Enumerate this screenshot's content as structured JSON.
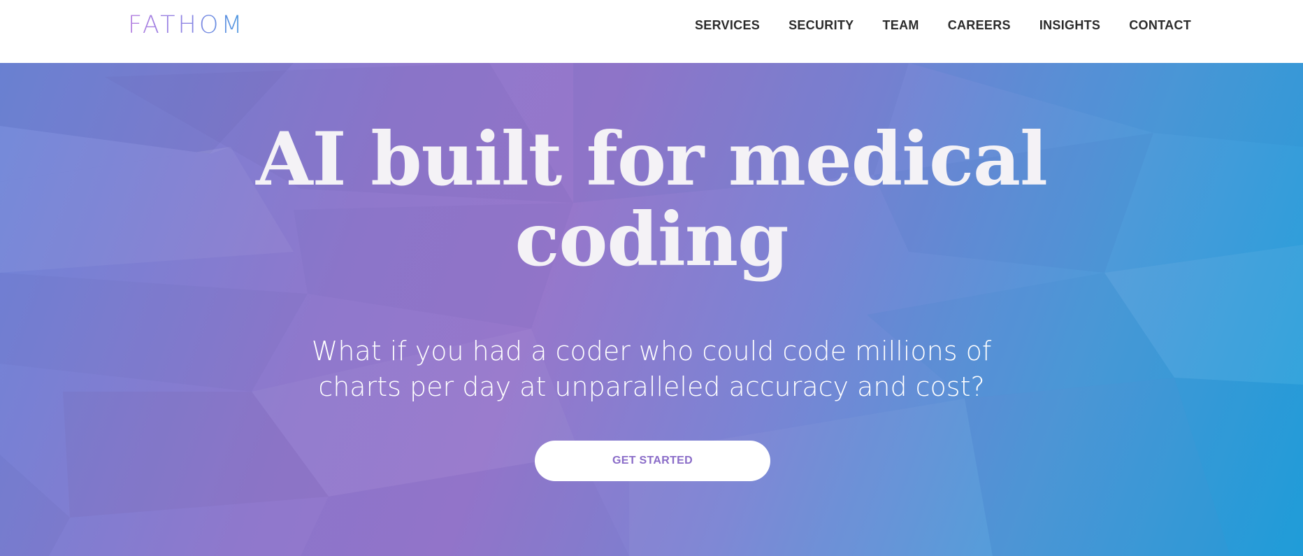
{
  "nav": {
    "logo": "FATHOM",
    "items": [
      {
        "label": "SERVICES"
      },
      {
        "label": "SECURITY"
      },
      {
        "label": "TEAM"
      },
      {
        "label": "CAREERS"
      },
      {
        "label": "INSIGHTS"
      },
      {
        "label": "CONTACT"
      }
    ]
  },
  "hero": {
    "title_line1": "AI built for medical",
    "title_line2": "coding",
    "subtitle_line1": "What if you had a coder who could code millions of",
    "subtitle_line2": "charts per day at unparalleled accuracy and cost?",
    "cta_label": "GET STARTED"
  },
  "colors": {
    "logo_gradient_start": "#b57ee0",
    "logo_gradient_end": "#4a9be0",
    "hero_purple": "#9677cb",
    "hero_blue": "#1ea0db",
    "cta_text": "#8a6cc8",
    "nav_text": "#2b2b2b"
  }
}
